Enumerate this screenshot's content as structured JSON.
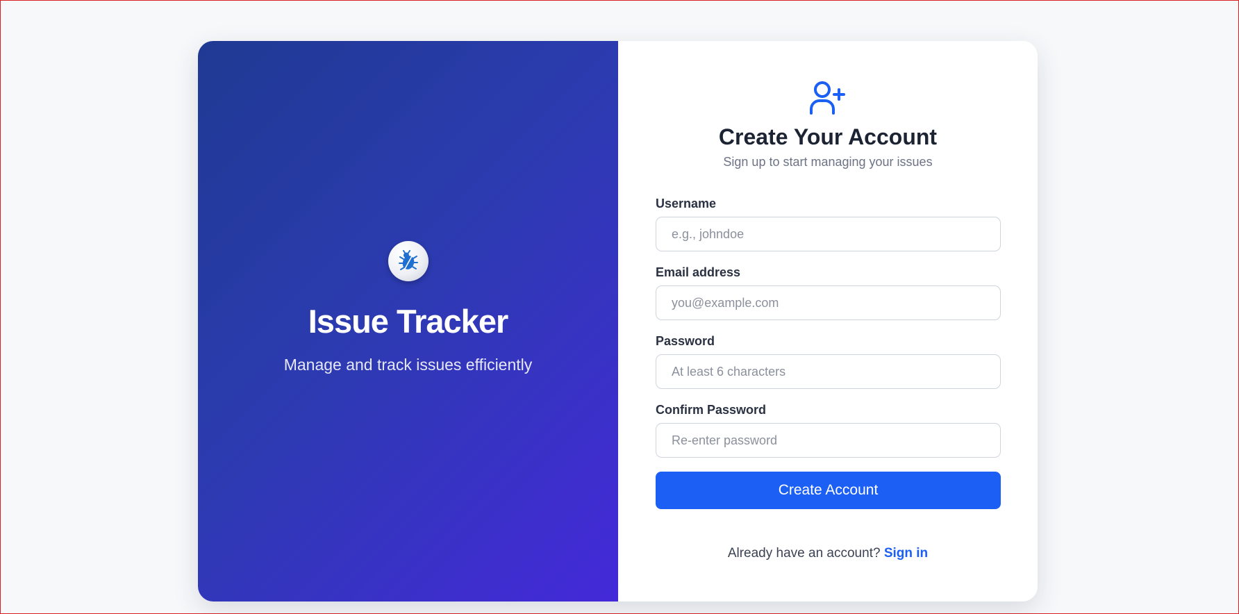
{
  "brand": {
    "icon": "bug-icon",
    "title": "Issue Tracker",
    "subtitle": "Manage and track issues efficiently"
  },
  "signup": {
    "icon": "user-plus-icon",
    "title": "Create Your Account",
    "subtitle": "Sign up to start managing your issues",
    "fields": {
      "username": {
        "label": "Username",
        "placeholder": "e.g., johndoe",
        "value": ""
      },
      "email": {
        "label": "Email address",
        "placeholder": "you@example.com",
        "value": ""
      },
      "password": {
        "label": "Password",
        "placeholder": "At least 6 characters",
        "value": ""
      },
      "confirm_password": {
        "label": "Confirm Password",
        "placeholder": "Re-enter password",
        "value": ""
      }
    },
    "submit_label": "Create Account",
    "footer_text": "Already have an account?",
    "signin_label": "Sign in"
  },
  "colors": {
    "accent": "#1b5ff5",
    "brand_gradient_start": "#1f3a93",
    "brand_gradient_end": "#4429d9",
    "title_text": "#1c2433"
  }
}
